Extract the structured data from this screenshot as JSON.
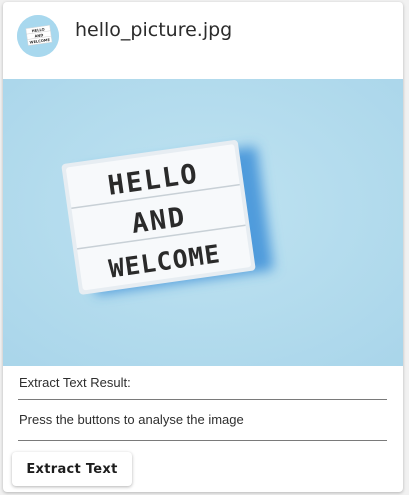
{
  "card": {
    "title": "hello_picture.jpg",
    "image": {
      "lightbox_lines": [
        "HELLO",
        "AND",
        "WELCOME"
      ]
    },
    "result_label": "Extract Text Result:",
    "result_text": "Press the buttons to analyse the image",
    "extract_button_label": "Extract Text"
  },
  "colors": {
    "background": "#b2dbec",
    "lightbox": "#f7f9fb",
    "lightbox_text": "#2a2a2a"
  }
}
